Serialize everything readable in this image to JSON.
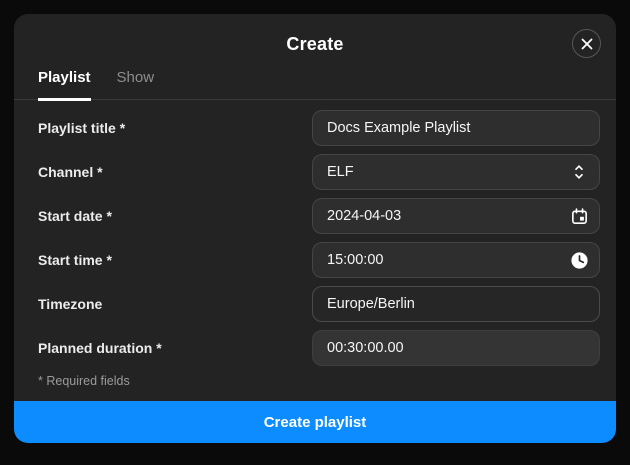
{
  "modal": {
    "title": "Create"
  },
  "tabs": [
    {
      "label": "Playlist",
      "active": true
    },
    {
      "label": "Show",
      "active": false
    }
  ],
  "form": {
    "fields": [
      {
        "label": "Playlist title *",
        "value": "Docs Example Playlist",
        "type": "text",
        "icon": null
      },
      {
        "label": "Channel *",
        "value": "ELF",
        "type": "select",
        "icon": "select-chevrons-icon"
      },
      {
        "label": "Start date *",
        "value": "2024-04-03",
        "type": "date",
        "icon": "calendar-icon"
      },
      {
        "label": "Start time *",
        "value": "15:00:00",
        "type": "time",
        "icon": "clock-icon"
      },
      {
        "label": "Timezone",
        "value": "Europe/Berlin",
        "type": "text",
        "icon": null
      },
      {
        "label": "Planned duration *",
        "value": "00:30:00.00",
        "type": "text",
        "icon": null
      }
    ],
    "required_note": "* Required fields"
  },
  "footer": {
    "submit_label": "Create playlist"
  },
  "colors": {
    "accent": "#0d8cff",
    "modal_background": "#232323",
    "input_background": "#2e2e2e"
  }
}
